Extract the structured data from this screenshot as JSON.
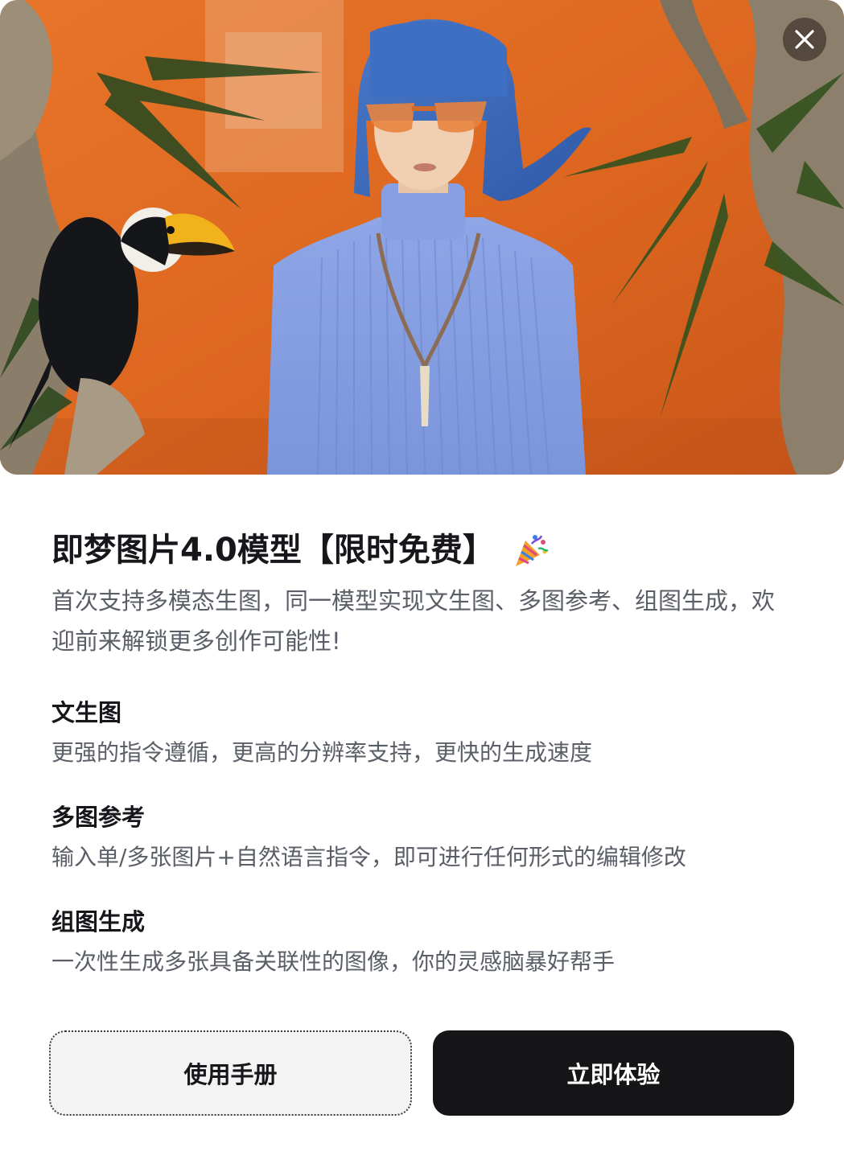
{
  "dialog": {
    "title": "即梦图片4.0模型【限时免费】",
    "intro": "首次支持多模态生图，同一模型实现文生图、多图参考、组图生成，欢迎前来解锁更多创作可能性!",
    "features": [
      {
        "title": "文生图",
        "description": "更强的指令遵循，更高的分辨率支持，更快的生成速度"
      },
      {
        "title": "多图参考",
        "description": "输入单/多张图片+自然语言指令，即可进行任何形式的编辑修改"
      },
      {
        "title": "组图生成",
        "description": "一次性生成多张具备关联性的图像，你的灵感脑暴好帮手"
      }
    ],
    "buttons": {
      "manual_label": "使用手册",
      "try_label": "立即体验"
    },
    "icons": {
      "close": "close-icon",
      "celebration": "party-popper-icon"
    },
    "colors": {
      "primary_button": "#151517",
      "secondary_button": "#f3f3f3",
      "hero_background": "#e06a22",
      "title_text": "#16171b",
      "body_text": "#5a5e66"
    }
  }
}
